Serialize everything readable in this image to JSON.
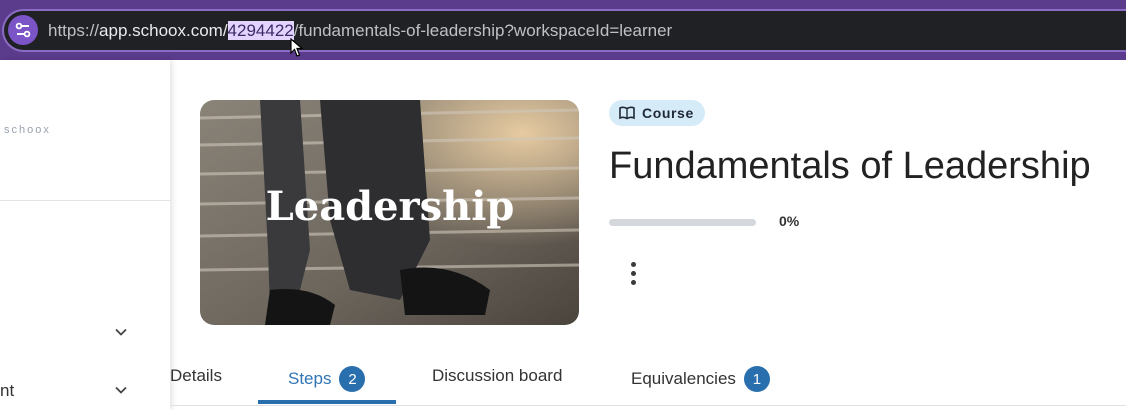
{
  "browser": {
    "url_scheme": "https://",
    "url_host": "app.schoox.com/",
    "url_selected": "4294422",
    "url_rest": "/fundamentals-of-leadership?workspaceId=learner",
    "site_icon": "tune-icon"
  },
  "sidebar": {
    "brand": "schoox",
    "items": [
      {
        "label": "",
        "icon": "chevron-down-icon"
      },
      {
        "label": "nt",
        "icon": "chevron-down-icon"
      }
    ]
  },
  "course": {
    "image_text": "Leadership",
    "badge_label": "Course",
    "badge_icon": "book-open-icon",
    "title": "Fundamentals of Leadership",
    "progress_fraction": 0,
    "progress_text": "0%"
  },
  "tabs": [
    {
      "label": "Details",
      "count": null
    },
    {
      "label": "Steps",
      "count": "2",
      "active": true
    },
    {
      "label": "Discussion board",
      "count": null
    },
    {
      "label": "Equivalencies",
      "count": "1"
    }
  ],
  "colors": {
    "browser_frame": "#5b3b8c",
    "accent": "#2a6fad",
    "badge_bg": "#d6ebf8"
  }
}
